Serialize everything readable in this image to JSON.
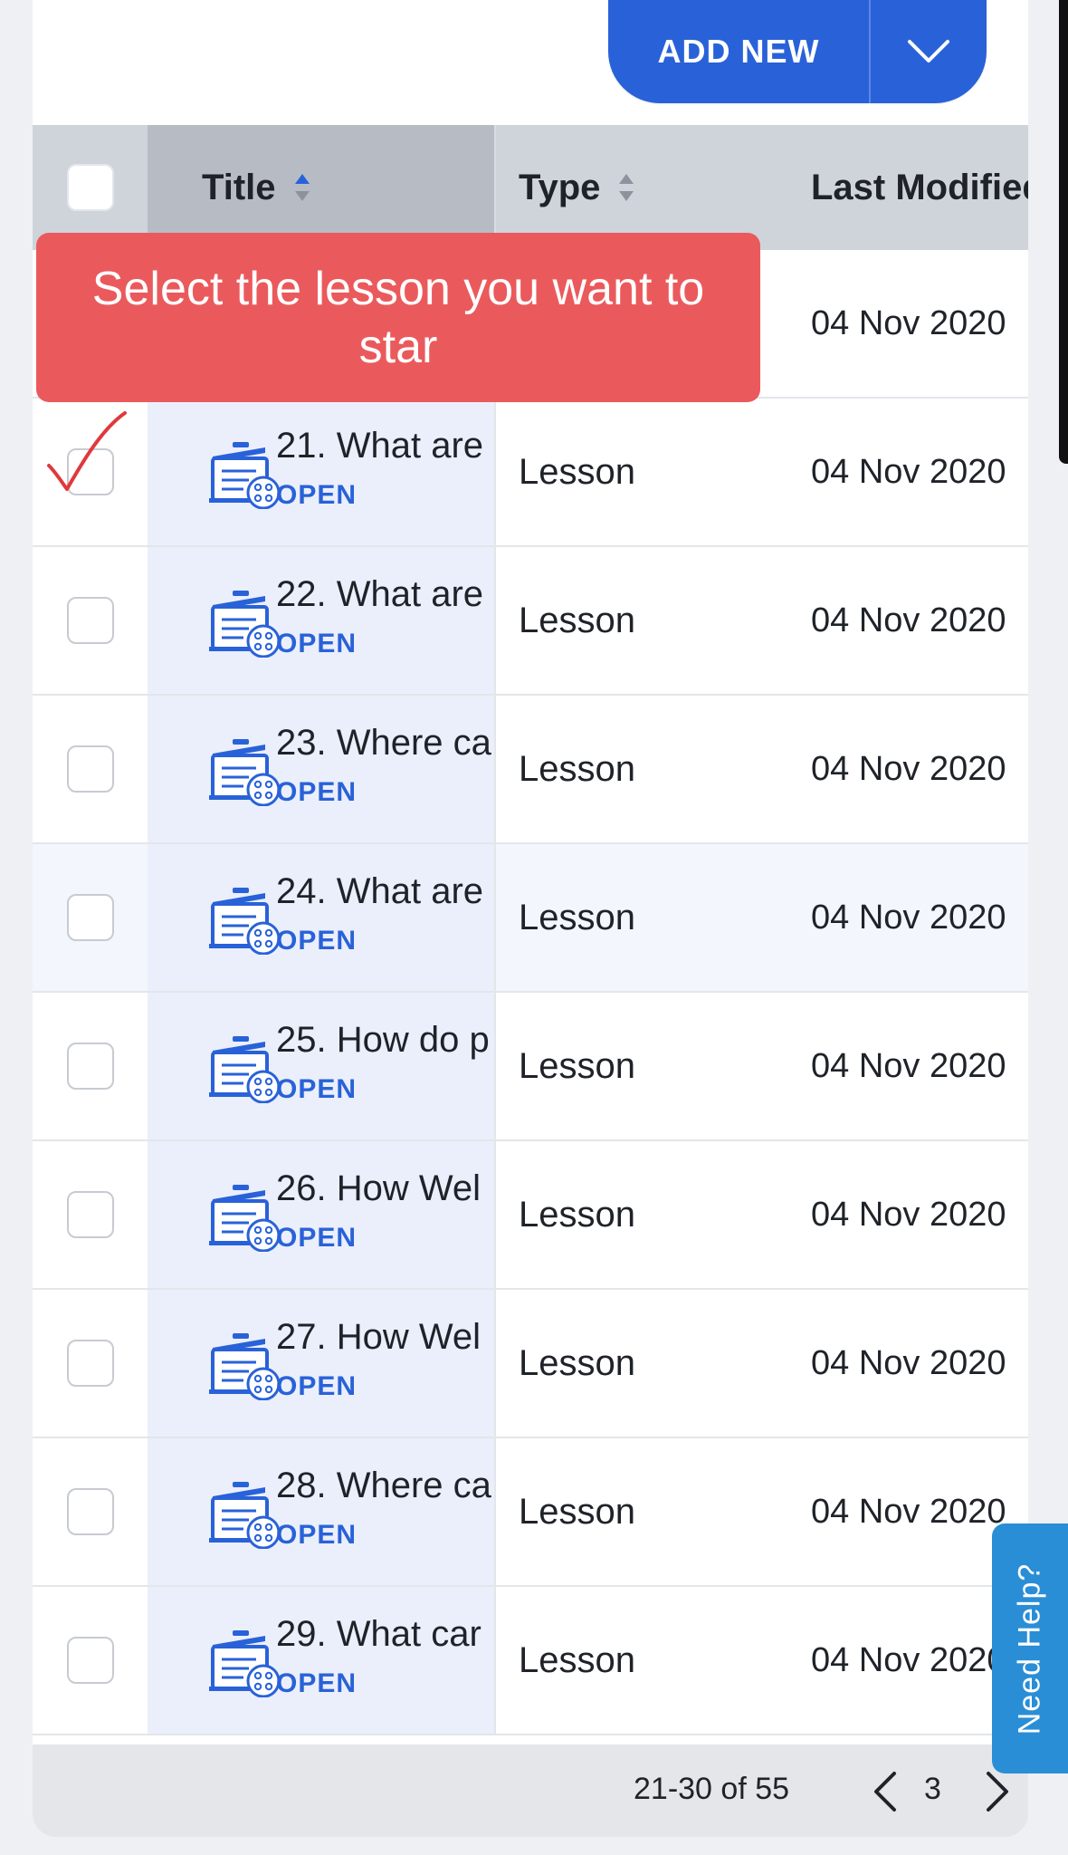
{
  "toolbar": {
    "add_new_label": "ADD NEW"
  },
  "table": {
    "columns": {
      "title": "Title",
      "type": "Type",
      "last_modified": "Last Modified"
    },
    "rows": [
      {
        "title": "",
        "type": "",
        "modified": "04 Nov 2020"
      },
      {
        "title": "21. What are",
        "open": "OPEN",
        "type": "Lesson",
        "modified": "04 Nov 2020"
      },
      {
        "title": "22. What are",
        "open": "OPEN",
        "type": "Lesson",
        "modified": "04 Nov 2020"
      },
      {
        "title": "23. Where ca",
        "open": "OPEN",
        "type": "Lesson",
        "modified": "04 Nov 2020"
      },
      {
        "title": "24. What are",
        "open": "OPEN",
        "type": "Lesson",
        "modified": "04 Nov 2020"
      },
      {
        "title": "25. How do p",
        "open": "OPEN",
        "type": "Lesson",
        "modified": "04 Nov 2020"
      },
      {
        "title": "26. How Wel",
        "open": "OPEN",
        "type": "Lesson",
        "modified": "04 Nov 2020"
      },
      {
        "title": "27. How Wel",
        "open": "OPEN",
        "type": "Lesson",
        "modified": "04 Nov 2020"
      },
      {
        "title": "28. Where ca",
        "open": "OPEN",
        "type": "Lesson",
        "modified": "04 Nov 2020"
      },
      {
        "title": "29. What car",
        "open": "OPEN",
        "type": "Lesson",
        "modified": "04 Nov 2020"
      }
    ]
  },
  "tooltip": {
    "text": "Select the lesson you want to star"
  },
  "pagination": {
    "range": "21-30 of 55",
    "page": "3"
  },
  "help": {
    "label": "Need Help?"
  },
  "colors": {
    "primary": "#2962d8",
    "tooltip": "#ea5a5c",
    "help": "#2a8ed6"
  }
}
